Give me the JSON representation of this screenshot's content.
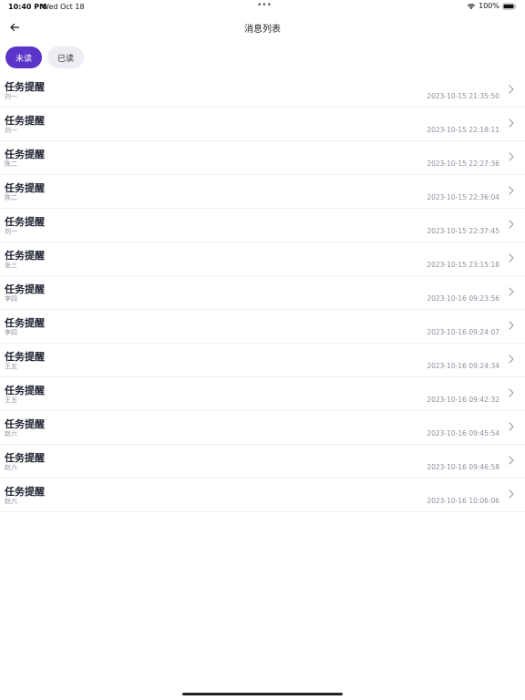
{
  "status_bar": {
    "time": "10:40 PM",
    "date": "Wed Oct 18",
    "dots": "•••",
    "battery": "100%"
  },
  "nav": {
    "title": "消息列表"
  },
  "tabs": [
    {
      "label": "未读",
      "active": true
    },
    {
      "label": "已读",
      "active": false
    }
  ],
  "messages": [
    {
      "title": "任务提醒",
      "sender": "刘一",
      "time": "2023-10-15 21:35:50"
    },
    {
      "title": "任务提醒",
      "sender": "刘一",
      "time": "2023-10-15 22:18:11"
    },
    {
      "title": "任务提醒",
      "sender": "陈二",
      "time": "2023-10-15 22:27:36"
    },
    {
      "title": "任务提醒",
      "sender": "陈二",
      "time": "2023-10-15 22:36:04"
    },
    {
      "title": "任务提醒",
      "sender": "刘一",
      "time": "2023-10-15 22:37:45"
    },
    {
      "title": "任务提醒",
      "sender": "张三",
      "time": "2023-10-15 23:15:18"
    },
    {
      "title": "任务提醒",
      "sender": "李四",
      "time": "2023-10-16 09:23:56"
    },
    {
      "title": "任务提醒",
      "sender": "李四",
      "time": "2023-10-16 09:24:07"
    },
    {
      "title": "任务提醒",
      "sender": "王五",
      "time": "2023-10-16 09:24:34"
    },
    {
      "title": "任务提醒",
      "sender": "王五",
      "time": "2023-10-16 09:42:32"
    },
    {
      "title": "任务提醒",
      "sender": "赵六",
      "time": "2023-10-16 09:45:54"
    },
    {
      "title": "任务提醒",
      "sender": "赵六",
      "time": "2023-10-16 09:46:58"
    },
    {
      "title": "任务提醒",
      "sender": "赵六",
      "time": "2023-10-16 10:06:06"
    }
  ],
  "colors": {
    "accent": "#5b35c9",
    "inactive_tab": "#eceef3",
    "muted_text": "#8a8f9c"
  },
  "icons": {
    "back": "arrow-left-icon",
    "chevron": "chevron-right-icon",
    "wifi": "wifi-icon",
    "battery": "battery-icon"
  }
}
